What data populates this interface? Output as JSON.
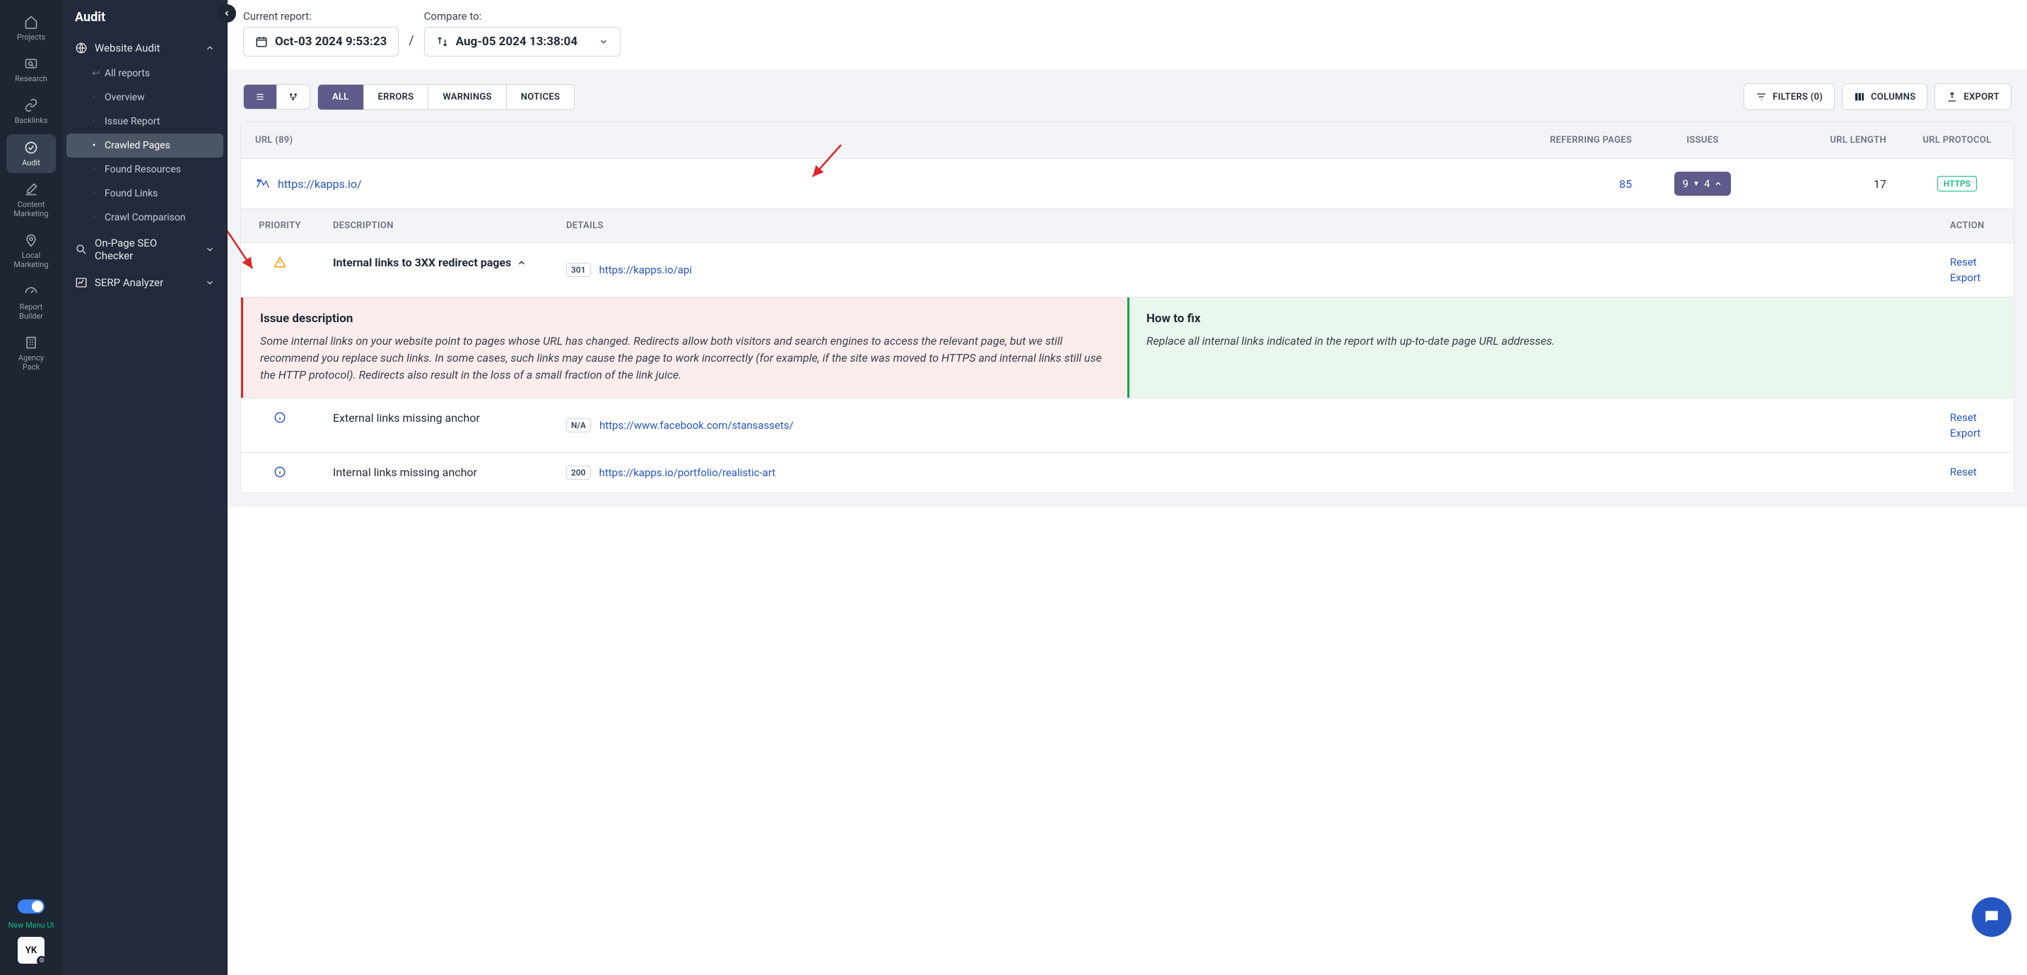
{
  "colors": {
    "accent": "#5e5b8a",
    "link": "#2555c0",
    "danger": "#dc2626",
    "success": "#16a34a"
  },
  "iconNav": {
    "items": [
      {
        "label": "Projects"
      },
      {
        "label": "Research"
      },
      {
        "label": "Backlinks"
      },
      {
        "label": "Audit"
      },
      {
        "label": "Content Marketing"
      },
      {
        "label": "Local Marketing"
      },
      {
        "label": "Report Builder"
      },
      {
        "label": "Agency Pack"
      }
    ],
    "newMenu": "New Menu UI",
    "avatar": "YK"
  },
  "sidebar": {
    "title": "Audit",
    "section1": {
      "label": "Website Audit"
    },
    "menu": [
      {
        "label": "All reports",
        "back": true
      },
      {
        "label": "Overview"
      },
      {
        "label": "Issue Report"
      },
      {
        "label": "Crawled Pages",
        "active": true
      },
      {
        "label": "Found Resources"
      },
      {
        "label": "Found Links"
      },
      {
        "label": "Crawl Comparison"
      }
    ],
    "section2": {
      "label": "On-Page SEO Checker"
    },
    "section3": {
      "label": "SERP Analyzer"
    }
  },
  "topbar": {
    "currentLabel": "Current report:",
    "currentValue": "Oct-03 2024 9:53:23",
    "compareLabel": "Compare to:",
    "compareValue": "Aug-05 2024 13:38:04"
  },
  "toolbar": {
    "tabs": [
      "ALL",
      "ERRORS",
      "WARNINGS",
      "NOTICES"
    ],
    "filters": "FILTERS (0)",
    "columns": "COLUMNS",
    "export": "EXPORT"
  },
  "table": {
    "headers": {
      "url": "URL  (89)",
      "ref": "REFERRING PAGES",
      "issues": "ISSUES",
      "len": "URL LENGTH",
      "proto": "URL PROTOCOL"
    },
    "row": {
      "url": "https://kapps.io/",
      "ref": "85",
      "issues": {
        "total": "9",
        "down": "4"
      },
      "len": "17",
      "proto": "HTTPS"
    }
  },
  "subtable": {
    "headers": {
      "pri": "PRIORITY",
      "desc": "DESCRIPTION",
      "det": "DETAILS",
      "act": "ACTION"
    },
    "rows": [
      {
        "pri": "warn",
        "desc": "Internal links to 3XX redirect pages",
        "code": "301",
        "link": "https://kapps.io/api",
        "actions": [
          "Reset",
          "Export"
        ],
        "expanded": true
      },
      {
        "pri": "info",
        "desc": "External links missing anchor",
        "code": "N/A",
        "link": "https://www.facebook.com/stansassets/",
        "actions": [
          "Reset",
          "Export"
        ]
      },
      {
        "pri": "info",
        "desc": "Internal links missing anchor",
        "code": "200",
        "link": "https://kapps.io/portfolio/realistic-art",
        "actions": [
          "Reset"
        ]
      }
    ]
  },
  "expand": {
    "leftTitle": "Issue description",
    "leftBody": "Some internal links on your website point to pages whose URL has changed. Redirects allow both visitors and search engines to access the relevant page, but we still recommend you replace such links. In some cases, such links may cause the page to work incorrectly (for example, if the site was moved to HTTPS and internal links still use the HTTP protocol). Redirects also result in the loss of a small fraction of the link juice.",
    "rightTitle": "How to fix",
    "rightBody": "Replace all internal links indicated in the report with up-to-date page URL addresses."
  }
}
